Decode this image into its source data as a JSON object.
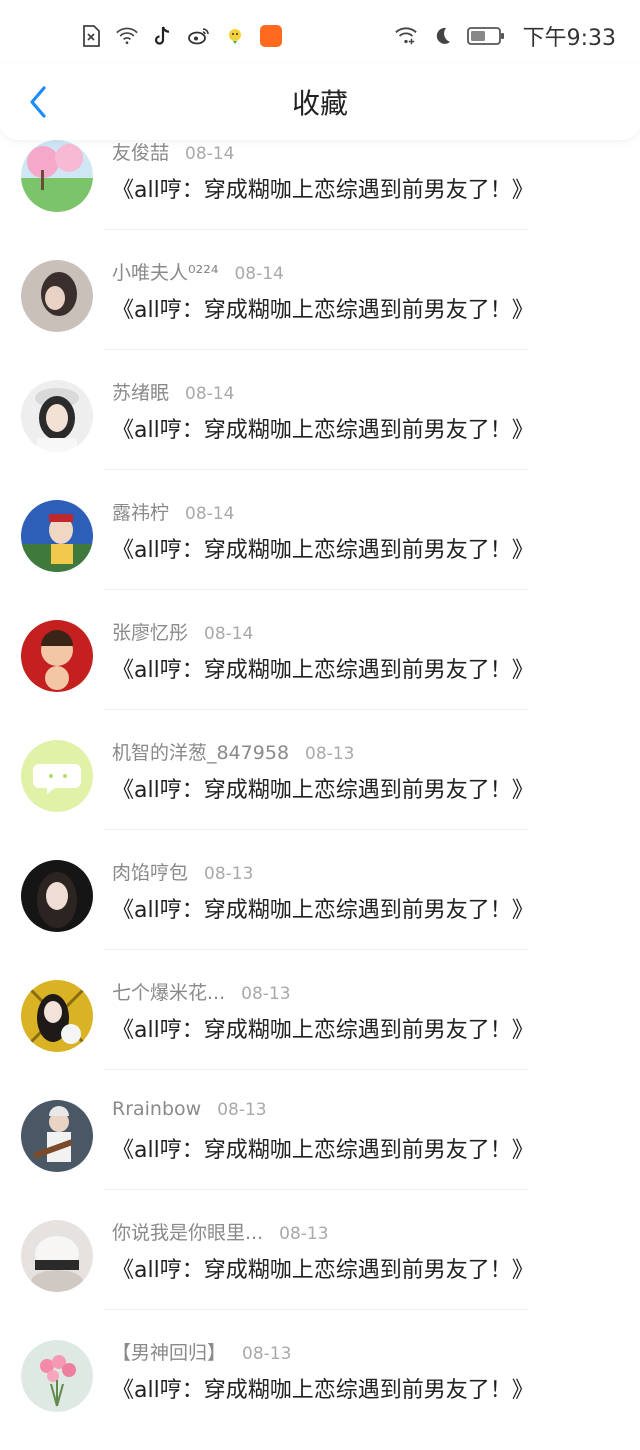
{
  "status_bar": {
    "time": "下午9:33",
    "icons": [
      "sim-error-icon",
      "wifi-icon",
      "tiktok-icon",
      "weibo-icon",
      "chick-icon",
      "orange-app-icon",
      "wifi-add-icon",
      "moon-icon",
      "battery-icon"
    ],
    "accent_app_color": "#ff6a1f"
  },
  "header": {
    "title": "收藏",
    "back_icon": "chevron-left-icon",
    "accent_color": "#1a8cff"
  },
  "favorites": [
    {
      "user": "友俊喆",
      "date": "08-14",
      "title": "《all哼：穿成糊咖上恋综遇到前男友了！》"
    },
    {
      "user": "小唯夫人⁰²²⁴",
      "date": "08-14",
      "title": "《all哼：穿成糊咖上恋综遇到前男友了！》"
    },
    {
      "user": "苏绪眠",
      "date": "08-14",
      "title": "《all哼：穿成糊咖上恋综遇到前男友了！》"
    },
    {
      "user": "露祎柠",
      "date": "08-14",
      "title": "《all哼：穿成糊咖上恋综遇到前男友了！》"
    },
    {
      "user": "张廖忆彤",
      "date": "08-14",
      "title": "《all哼：穿成糊咖上恋综遇到前男友了！》"
    },
    {
      "user": "机智的洋葱_847958",
      "date": "08-13",
      "title": "《all哼：穿成糊咖上恋综遇到前男友了！》"
    },
    {
      "user": "肉馅哼包",
      "date": "08-13",
      "title": "《all哼：穿成糊咖上恋综遇到前男友了！》"
    },
    {
      "user": "七个爆米花...",
      "date": "08-13",
      "title": "《all哼：穿成糊咖上恋综遇到前男友了！》"
    },
    {
      "user": "Rrainbow",
      "date": "08-13",
      "title": "《all哼：穿成糊咖上恋综遇到前男友了！》"
    },
    {
      "user": "你说我是你眼里...",
      "date": "08-13",
      "title": "《all哼：穿成糊咖上恋综遇到前男友了！》"
    },
    {
      "user": "【男神回归】",
      "date": "08-13",
      "title": "《all哼：穿成糊咖上恋综遇到前男友了！》"
    }
  ]
}
